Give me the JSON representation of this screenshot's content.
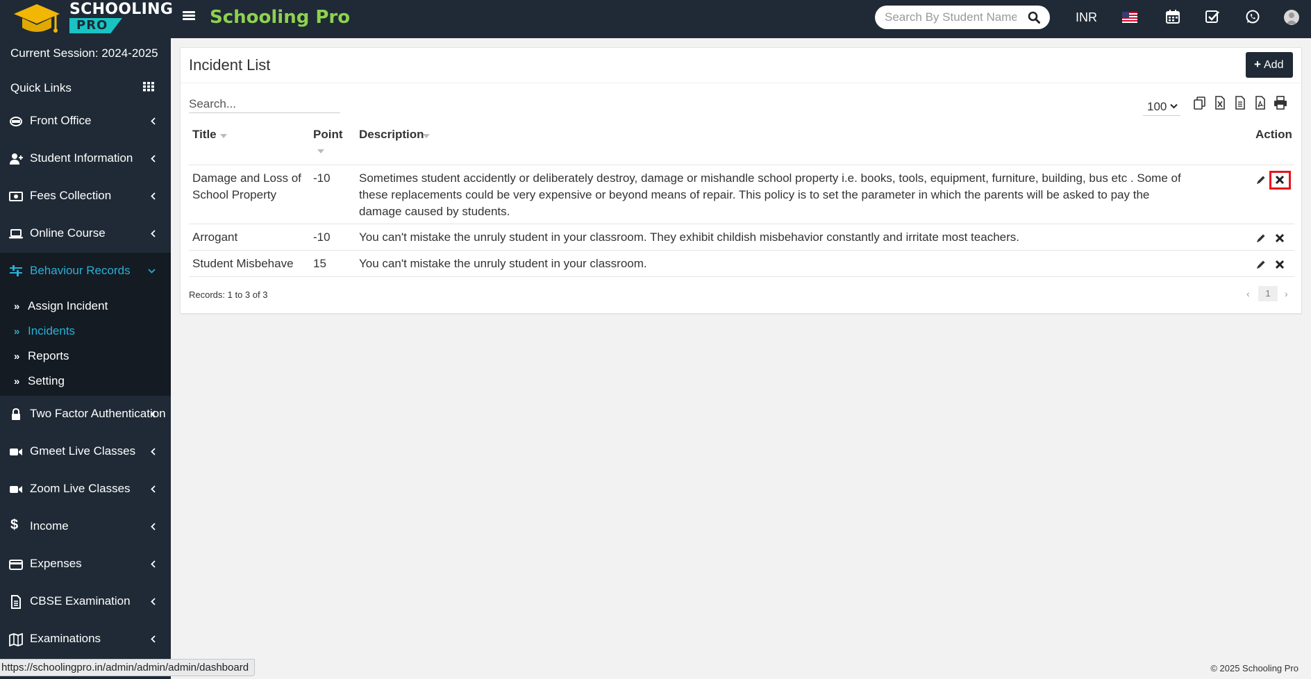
{
  "brand": {
    "logo_line1": "SCHOOLING",
    "logo_line2": "PRO",
    "app_name": "Schooling Pro"
  },
  "topbar": {
    "search_placeholder": "Search By Student Name",
    "currency": "INR",
    "icons": [
      "us-flag-icon",
      "calendar-icon",
      "checkbox-icon",
      "whatsapp-icon",
      "user-avatar"
    ]
  },
  "sidebar": {
    "session": "Current Session: 2024-2025",
    "quick_links": "Quick Links",
    "menu": [
      {
        "label": "Front Office",
        "icon": "front-office-icon"
      },
      {
        "label": "Student Information",
        "icon": "user-plus-icon"
      },
      {
        "label": "Fees Collection",
        "icon": "money-icon"
      },
      {
        "label": "Online Course",
        "icon": "laptop-icon"
      },
      {
        "label": "Behaviour Records",
        "icon": "sliders-icon",
        "active": true
      },
      {
        "label": "Two Factor Authentication",
        "icon": "lock-icon"
      },
      {
        "label": "Gmeet Live Classes",
        "icon": "video-icon"
      },
      {
        "label": "Zoom Live Classes",
        "icon": "video-icon"
      },
      {
        "label": "Income",
        "icon": "dollar-icon"
      },
      {
        "label": "Expenses",
        "icon": "credit-card-icon"
      },
      {
        "label": "CBSE Examination",
        "icon": "document-icon"
      },
      {
        "label": "Examinations",
        "icon": "map-icon"
      }
    ],
    "submenu": [
      {
        "label": "Assign Incident"
      },
      {
        "label": "Incidents",
        "current": true
      },
      {
        "label": "Reports"
      },
      {
        "label": "Setting"
      }
    ]
  },
  "panel": {
    "title": "Incident List",
    "add_label": "Add",
    "search_placeholder": "Search...",
    "page_size": "100",
    "export_icons": [
      "copy-icon",
      "excel-icon",
      "csv-icon",
      "pdf-icon",
      "print-icon"
    ],
    "columns": [
      "Title",
      "Point",
      "Description",
      "Action"
    ],
    "rows": [
      {
        "title": "Damage and Loss of School Property",
        "point": "-10",
        "description": "Sometimes student accidently or deliberately destroy, damage or mishandle school property i.e. books, tools, equipment, furniture, building, bus etc . Some of these replacements could be very expensive or beyond means of repair. This policy is to set the parameter in which the parents will be asked to pay the damage caused by students."
      },
      {
        "title": "Arrogant",
        "point": "-10",
        "description": "You can't mistake the unruly student in your classroom. They exhibit childish misbehavior constantly and irritate most teachers."
      },
      {
        "title": "Student Misbehave",
        "point": "15",
        "description": "You can't mistake the unruly student in your classroom."
      }
    ],
    "records": "Records: 1 to 3 of 3",
    "page": "1"
  },
  "footer": {
    "status_url": "https://schoolingpro.in/admin/admin/admin/dashboard",
    "copyright": "© 2025 Schooling Pro"
  },
  "colors": {
    "sidebar_bg": "#1f2a36",
    "accent": "#2ab0d6",
    "brand_green": "#8fd14f",
    "highlight": "#e8131b"
  }
}
